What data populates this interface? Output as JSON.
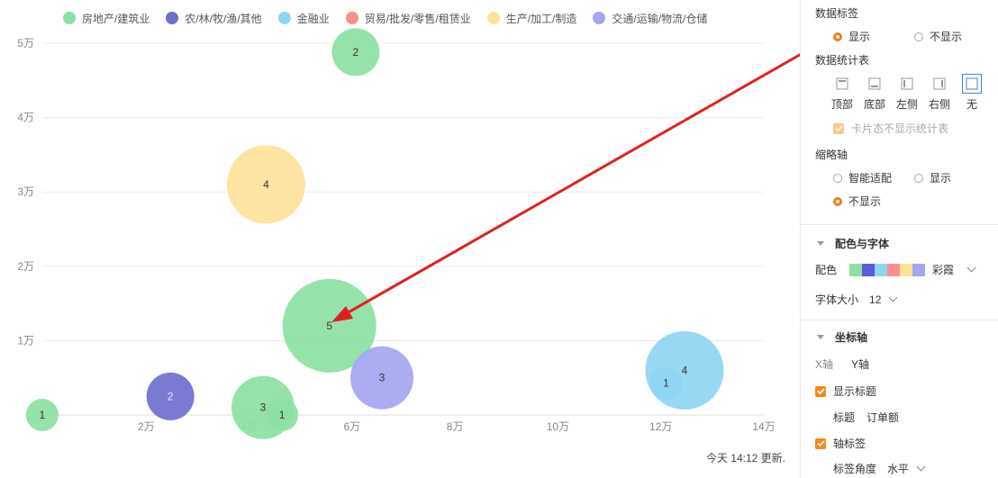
{
  "chart_data": {
    "type": "bubble",
    "legend": [
      {
        "name": "房地产/建筑业",
        "color": "#8de0a4"
      },
      {
        "name": "农/林/牧/渔/其他",
        "color": "#6f6fcf"
      },
      {
        "name": "金融业",
        "color": "#8fd5f2"
      },
      {
        "name": "贸易/批发/零售/租赁业",
        "color": "#f79191"
      },
      {
        "name": "生产/加工/制造",
        "color": "#fde29a"
      },
      {
        "name": "交通/运输/物流/仓储",
        "color": "#a5a5f2"
      }
    ],
    "xlim": [
      0,
      140000
    ],
    "ylim": [
      0,
      50000
    ],
    "x_ticks": [
      20000,
      40000,
      60000,
      80000,
      100000,
      120000,
      140000
    ],
    "x_tick_labels": [
      "2万",
      "4万",
      "6万",
      "8万",
      "10万",
      "12万",
      "14万"
    ],
    "y_ticks": [
      10000,
      20000,
      30000,
      40000,
      50000
    ],
    "y_tick_labels": [
      "1万",
      "2万",
      "3万",
      "4万",
      "5万"
    ],
    "points": [
      {
        "series": "房地产/建筑业",
        "x": -200,
        "y": 0,
        "label": "1",
        "size": 1
      },
      {
        "series": "农/林/牧/渔/其他",
        "x": 24700,
        "y": 2500,
        "label": "2",
        "size": 2
      },
      {
        "series": "房地产/建筑业",
        "x": 42700,
        "y": 1000,
        "label": "3",
        "size": 3
      },
      {
        "series": "房地产/建筑业",
        "x": 46400,
        "y": 0,
        "label": "1",
        "size": 1
      },
      {
        "series": "生产/加工/制造",
        "x": 43300,
        "y": 31000,
        "label": "4",
        "size": 4
      },
      {
        "series": "房地产/建筑业",
        "x": 60700,
        "y": 48800,
        "label": "2",
        "size": 2
      },
      {
        "series": "房地产/建筑业",
        "x": 55600,
        "y": 12000,
        "label": "5",
        "size": 5
      },
      {
        "series": "交通/运输/物流/仓储",
        "x": 65800,
        "y": 5000,
        "label": "3",
        "size": 3
      },
      {
        "series": "金融业",
        "x": 124600,
        "y": 6000,
        "label": "4",
        "size": 4
      },
      {
        "series": "金融业",
        "x": 121000,
        "y": 4300,
        "label": "1",
        "size": 1
      }
    ]
  },
  "update_time": "今天 14:12 更新.",
  "panel": {
    "data_label": {
      "title": "数据标签",
      "options": [
        "显示",
        "不显示"
      ],
      "selected": "显示"
    },
    "stat_table": {
      "title": "数据统计表",
      "positions": [
        "顶部",
        "底部",
        "左侧",
        "右侧",
        "无"
      ],
      "selected": "无",
      "card_hide": "卡片态不显示统计表"
    },
    "thumb_axis": {
      "title": "缩略轴",
      "options": [
        "智能适配",
        "显示",
        "不显示"
      ],
      "selected": "不显示"
    },
    "color_font": {
      "title": "配色与字体",
      "palette_label": "配色",
      "palette_name": "彩霞",
      "swatches": [
        "#8de0a4",
        "#5b5bd6",
        "#8fd5f2",
        "#f79191",
        "#fde29a",
        "#a5a5f2"
      ],
      "font_size_label": "字体大小",
      "font_size": "12"
    },
    "axis": {
      "title": "坐标轴",
      "x_tab": "X轴",
      "y_tab": "Y轴",
      "show_title": "显示标题",
      "title_label": "标题",
      "title_value": "订单额",
      "axis_label": "轴标签",
      "angle_label": "标签角度",
      "angle_value": "水平"
    }
  }
}
